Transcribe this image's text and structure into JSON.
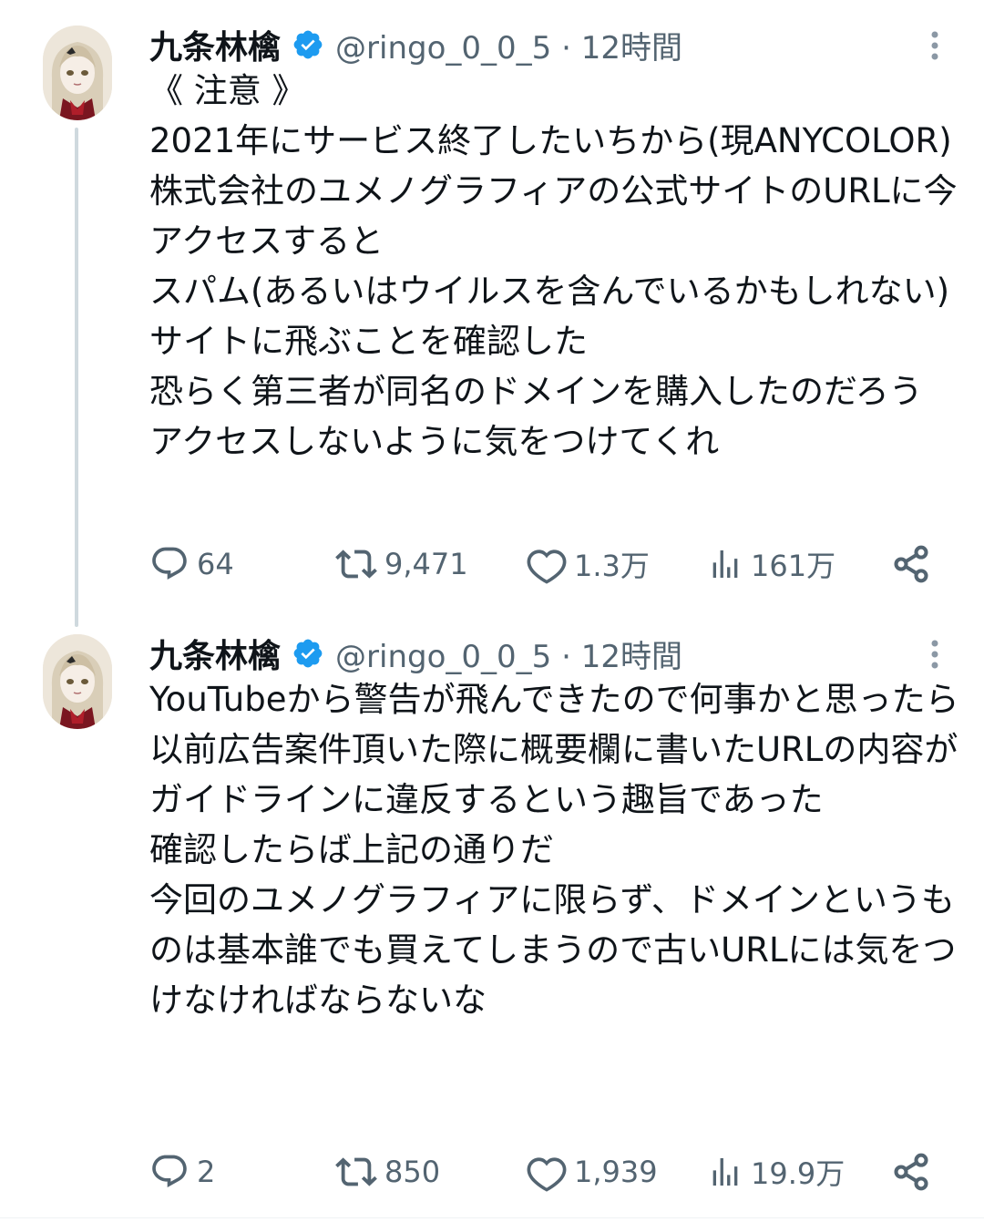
{
  "tweets": [
    {
      "author_name": "九条林檎",
      "handle_time": "@ringo_0_0_5 · 12時間",
      "text": "《 注意 》\n2021年にサービス終了したいちから(現ANYCOLOR)株式会社のユメノグラフィアの公式サイトのURLに今アクセスすると\nスパム(あるいはウイルスを含んでいるかもしれない)サイトに飛ぶことを確認した\n恐らく第三者が同名のドメインを購入したのだろう\nアクセスしないように気をつけてくれ",
      "replies": "64",
      "retweets": "9,471",
      "likes": "1.3万",
      "views": "161万"
    },
    {
      "author_name": "九条林檎",
      "handle_time": "@ringo_0_0_5 · 12時間",
      "text": "YouTubeから警告が飛んできたので何事かと思ったら\n以前広告案件頂いた際に概要欄に書いたURLの内容が\nガイドラインに違反するという趣旨であった\n確認したらば上記の通りだ\n今回のユメノグラフィアに限らず、ドメインというものは基本誰でも買えてしまうので古いURLには気をつけなければならないな",
      "replies": "2",
      "retweets": "850",
      "likes": "1,939",
      "views": "19.9万"
    }
  ],
  "icons": {
    "verified": "verified-badge-icon",
    "more": "more-vertical-icon",
    "reply": "reply-icon",
    "retweet": "retweet-icon",
    "like": "heart-icon",
    "views": "views-icon",
    "share": "share-icon"
  },
  "colors": {
    "verified_blue": "#1d9bf0",
    "text": "#0f1419",
    "secondary": "#536471",
    "thread_line": "#cfd9de"
  }
}
